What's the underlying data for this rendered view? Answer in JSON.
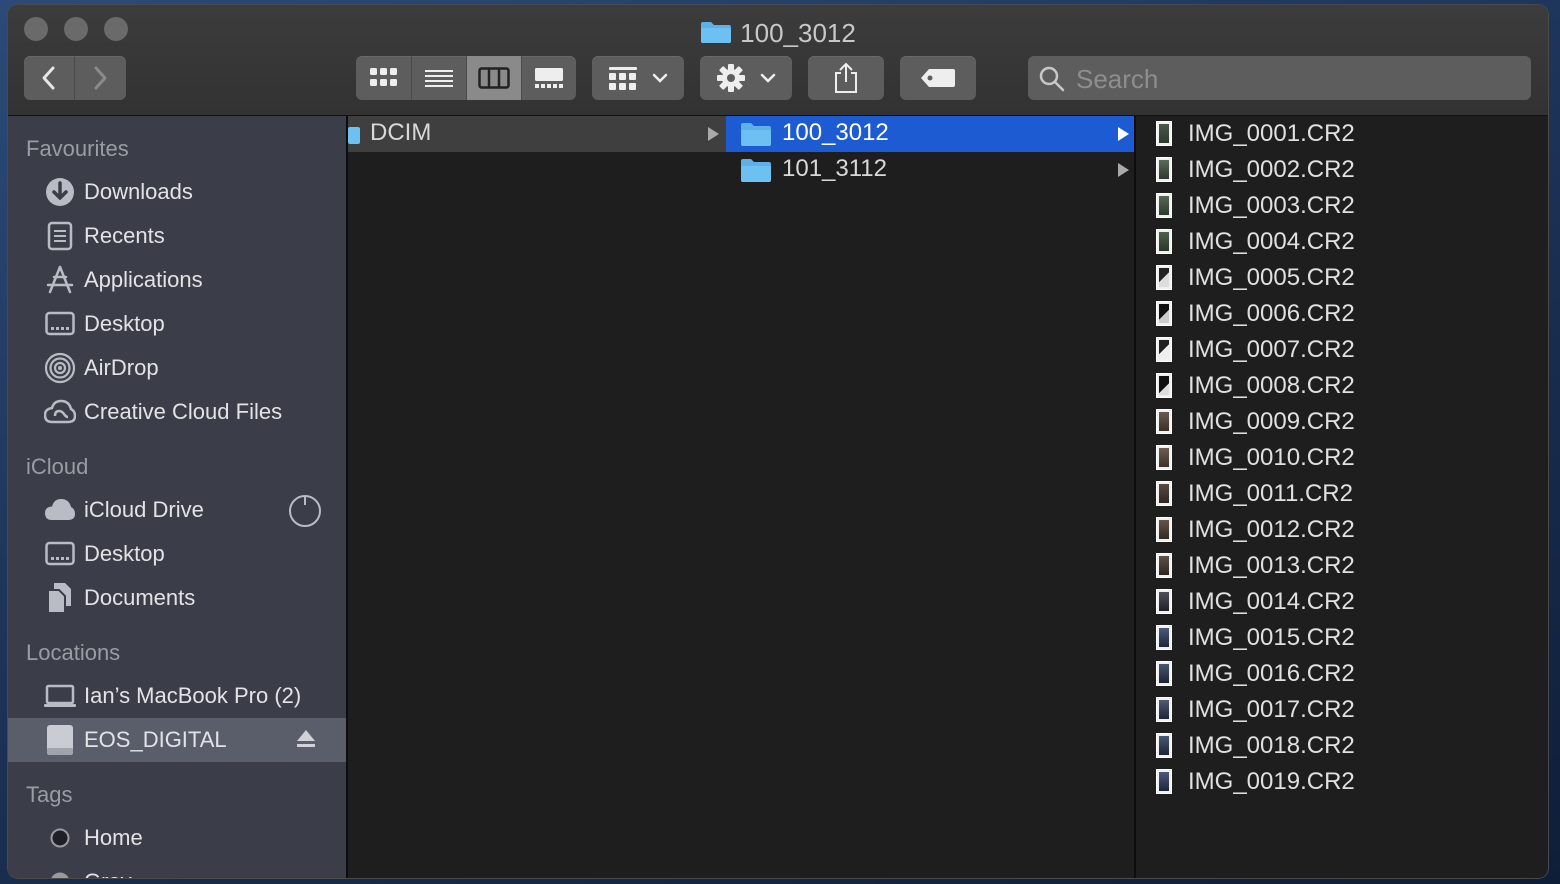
{
  "window": {
    "title": "100_3012"
  },
  "toolbar": {
    "back_icon": "chevron-left-icon",
    "forward_icon": "chevron-right-icon",
    "view_modes": [
      "icon-view-icon",
      "list-view-icon",
      "column-view-icon",
      "gallery-view-icon"
    ],
    "active_view": "column",
    "search_placeholder": "Search"
  },
  "sidebar": {
    "favourites_title": "Favourites",
    "favourites": [
      {
        "label": "Downloads",
        "icon": "downloads-icon"
      },
      {
        "label": "Recents",
        "icon": "recents-icon"
      },
      {
        "label": "Applications",
        "icon": "applications-icon"
      },
      {
        "label": "Desktop",
        "icon": "desktop-icon"
      },
      {
        "label": "AirDrop",
        "icon": "airdrop-icon"
      },
      {
        "label": "Creative Cloud Files",
        "icon": "creative-cloud-icon"
      }
    ],
    "icloud_title": "iCloud",
    "icloud": [
      {
        "label": "iCloud Drive",
        "icon": "icloud-icon"
      },
      {
        "label": "Desktop",
        "icon": "desktop-icon"
      },
      {
        "label": "Documents",
        "icon": "documents-icon"
      }
    ],
    "locations_title": "Locations",
    "locations": [
      {
        "label": "Ian’s MacBook Pro (2)",
        "icon": "laptop-icon"
      },
      {
        "label": "EOS_DIGITAL",
        "icon": "drive-icon",
        "selected": true
      }
    ],
    "tags_title": "Tags",
    "tags": [
      {
        "label": "Home",
        "color": "#1f2026"
      },
      {
        "label": "Gray",
        "color": "#9a9a9a"
      }
    ]
  },
  "columns": {
    "col1": [
      {
        "label": "DCIM",
        "selected": "grey"
      }
    ],
    "col2": [
      {
        "label": "100_3012",
        "selected": "blue"
      },
      {
        "label": "101_3112",
        "selected": "none"
      }
    ],
    "files": [
      "IMG_0001.CR2",
      "IMG_0002.CR2",
      "IMG_0003.CR2",
      "IMG_0004.CR2",
      "IMG_0005.CR2",
      "IMG_0006.CR2",
      "IMG_0007.CR2",
      "IMG_0008.CR2",
      "IMG_0009.CR2",
      "IMG_0010.CR2",
      "IMG_0011.CR2",
      "IMG_0012.CR2",
      "IMG_0013.CR2",
      "IMG_0014.CR2",
      "IMG_0015.CR2",
      "IMG_0016.CR2",
      "IMG_0017.CR2",
      "IMG_0018.CR2",
      "IMG_0019.CR2"
    ]
  },
  "colors": {
    "selection_blue": "#1c5bd1",
    "folder_blue": "#5fb0e8",
    "sidebar_bg": "#3b3e48"
  }
}
